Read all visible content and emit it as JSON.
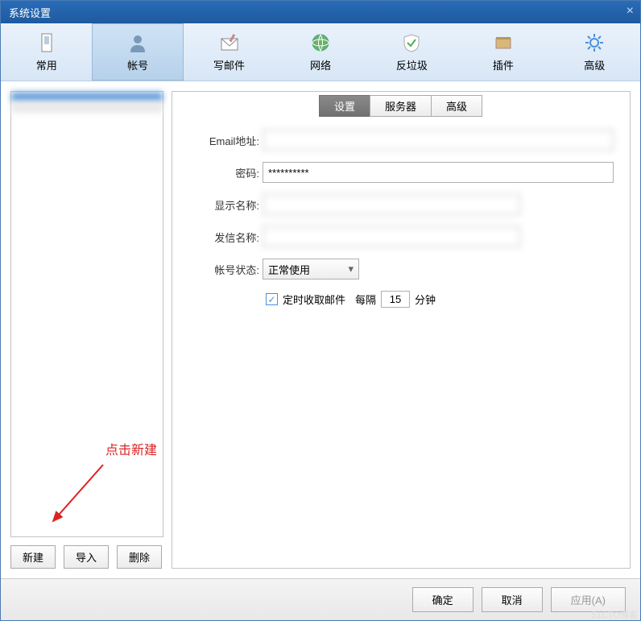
{
  "title": "系统设置",
  "toolbar": [
    {
      "name": "common",
      "label": "常用"
    },
    {
      "name": "account",
      "label": "帐号"
    },
    {
      "name": "compose",
      "label": "写邮件"
    },
    {
      "name": "network",
      "label": "网络"
    },
    {
      "name": "antispam",
      "label": "反垃圾"
    },
    {
      "name": "plugin",
      "label": "插件"
    },
    {
      "name": "advanced",
      "label": "高级"
    }
  ],
  "accounts": {
    "item0": " ",
    "item1": " "
  },
  "left_buttons": {
    "new": "新建",
    "import": "导入",
    "delete": "删除"
  },
  "subtabs": {
    "settings": "设置",
    "server": "服务器",
    "advanced": "高级"
  },
  "form": {
    "email_label": "Email地址:",
    "email_value": " ",
    "password_label": "密码:",
    "password_value": "**********",
    "display_label": "显示名称:",
    "display_value": " ",
    "sender_label": "发信名称:",
    "sender_value": " ",
    "status_label": "帐号状态:",
    "status_value": "正常使用",
    "timer_check": "定时收取邮件",
    "interval_label": "每隔",
    "interval_value": "15",
    "interval_unit": "分钟"
  },
  "footer": {
    "ok": "确定",
    "cancel": "取消",
    "apply": "应用(A)"
  },
  "annotation": "点击新建",
  "watermark": "51CTO博客"
}
